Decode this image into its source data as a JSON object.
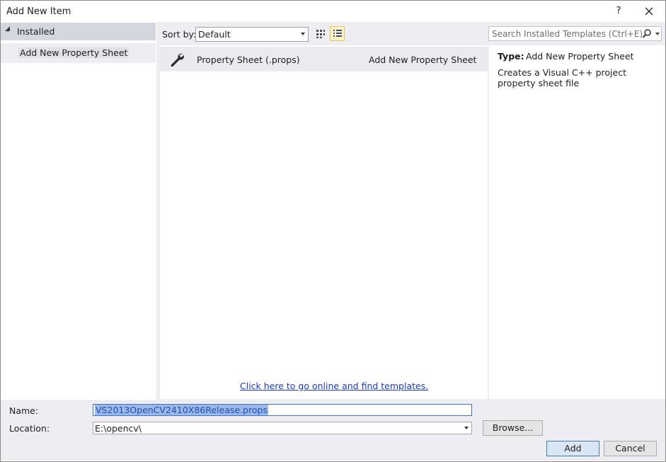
{
  "window": {
    "title": "Add New Item",
    "help_label": "?"
  },
  "sidebar": {
    "installed_label": "Installed",
    "items": [
      {
        "label": "Add New Property Sheet"
      }
    ]
  },
  "toolbar": {
    "sort_label": "Sort by:",
    "sort_value": "Default"
  },
  "search": {
    "placeholder": "Search Installed Templates (Ctrl+E)"
  },
  "templates": [
    {
      "name": "Property Sheet (.props)",
      "category": "Add New Property Sheet",
      "icon": "wrench-icon"
    }
  ],
  "online_link": "Click here to go online and find templates.",
  "details": {
    "type_label": "Type:",
    "type_value": "Add New Property Sheet",
    "description": "Creates a Visual C++ project property sheet file"
  },
  "form": {
    "name_label": "Name:",
    "name_value": "VS2013OpenCV2410X86Release.props",
    "location_label": "Location:",
    "location_value": "E:\\opencv\\",
    "browse_label": "Browse...",
    "add_label": "Add",
    "cancel_label": "Cancel"
  },
  "colors": {
    "selection": "#9bb8e6",
    "link": "#1a3ac2",
    "accent_view": "#fff4c8"
  }
}
